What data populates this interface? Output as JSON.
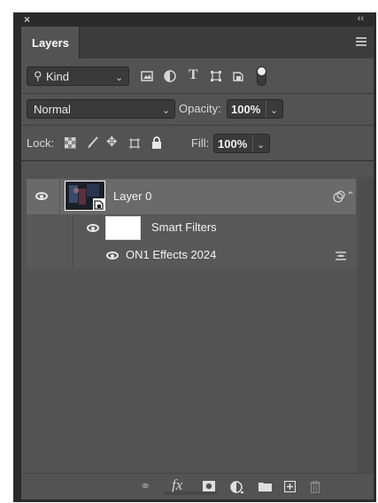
{
  "window": {
    "close_glyph": "×",
    "collapse_glyph": "‹‹"
  },
  "tab": {
    "label": "Layers"
  },
  "filter": {
    "kind_label": "Kind"
  },
  "blend": {
    "mode": "Normal",
    "opacity_label": "Opacity:",
    "opacity_value": "100%"
  },
  "lock": {
    "label": "Lock:",
    "fill_label": "Fill:",
    "fill_value": "100%"
  },
  "layers": {
    "layer0_name": "Layer 0",
    "smart_filters_label": "Smart Filters",
    "effect_name": "ON1 Effects 2024"
  },
  "footer": {
    "fx_label": "fx"
  },
  "colors": {
    "panel": "#535353",
    "selected_row": "#6a6a6a",
    "frame": "#2b2b2b"
  }
}
